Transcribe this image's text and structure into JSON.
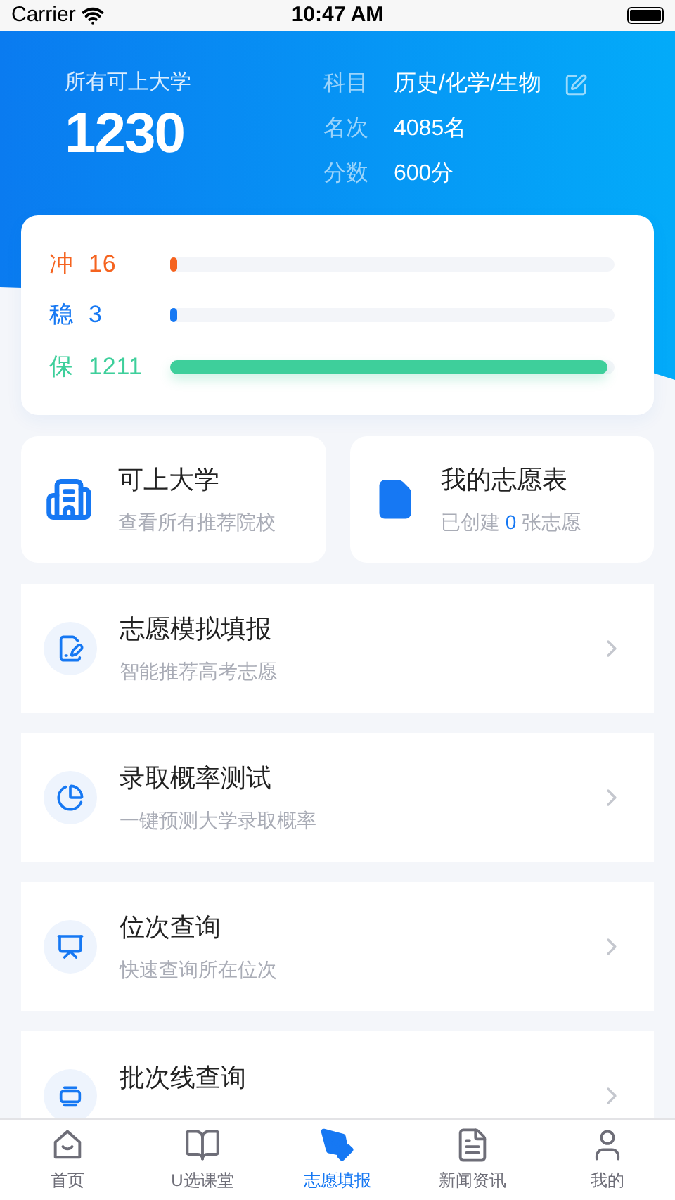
{
  "status_bar": {
    "carrier": "Carrier",
    "time": "10:47 AM"
  },
  "summary": {
    "label": "所有可上大学",
    "count": "1230",
    "details": [
      {
        "label": "科目",
        "value": "历史/化学/生物",
        "editable": true
      },
      {
        "label": "名次",
        "value": "4085名",
        "editable": false
      },
      {
        "label": "分数",
        "value": "600分",
        "editable": false
      }
    ]
  },
  "tiers": [
    {
      "label": "冲",
      "count": "16",
      "level": 0.013,
      "color": "#f5631f"
    },
    {
      "label": "稳",
      "count": "3",
      "level": 0.003,
      "color": "#1678f3"
    },
    {
      "label": "保",
      "count": "1211",
      "level": 0.985,
      "color": "#3ecf9b"
    }
  ],
  "shortcuts": [
    {
      "title": "可上大学",
      "subtitle": "查看所有推荐院校"
    },
    {
      "title": "我的志愿表",
      "subtitle_before": "已创建",
      "subtitle_count": "0",
      "subtitle_after": "张志愿"
    }
  ],
  "menu": [
    {
      "title": "志愿模拟填报",
      "subtitle": "智能推荐高考志愿"
    },
    {
      "title": "录取概率测试",
      "subtitle": "一键预测大学录取概率"
    },
    {
      "title": "位次查询",
      "subtitle": "快速查询所在位次"
    },
    {
      "title": "批次线查询"
    }
  ],
  "tab_bar": [
    {
      "label": "首页",
      "selected": false
    },
    {
      "label": "U选课堂",
      "selected": false
    },
    {
      "label": "志愿填报",
      "selected": true
    },
    {
      "label": "新闻资讯",
      "selected": false
    },
    {
      "label": "我的",
      "selected": false
    }
  ]
}
